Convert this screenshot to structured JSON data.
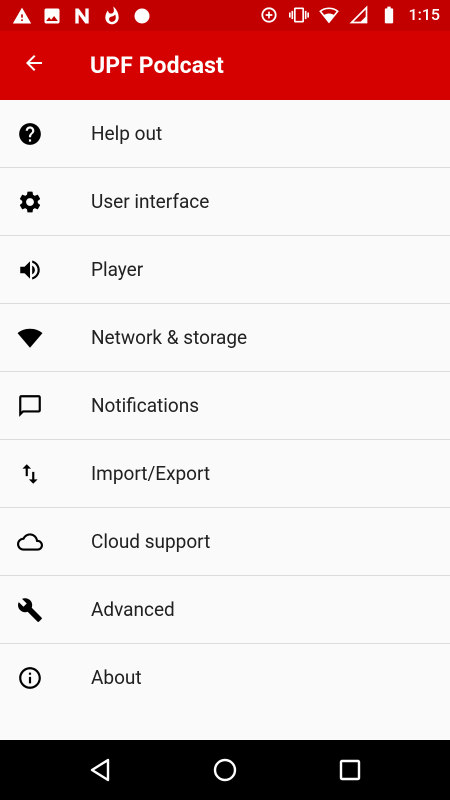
{
  "status_bar": {
    "time": "1:15",
    "left_icons": [
      "warning-icon",
      "image-icon",
      "n-logo-icon",
      "flame-icon",
      "circle-icon"
    ],
    "right_icons": [
      "data-saver-icon",
      "vibrate-icon",
      "wifi-icon",
      "signal-icon",
      "battery-icon"
    ]
  },
  "app_bar": {
    "title": "UPF Podcast",
    "back_icon": "arrow-back-icon"
  },
  "settings": [
    {
      "label": "Help out",
      "icon": "help-icon"
    },
    {
      "label": "User interface",
      "icon": "gear-icon"
    },
    {
      "label": "Player",
      "icon": "volume-icon"
    },
    {
      "label": "Network & storage",
      "icon": "wifi-icon"
    },
    {
      "label": "Notifications",
      "icon": "chat-bubble-icon"
    },
    {
      "label": "Import/Export",
      "icon": "swap-vertical-icon"
    },
    {
      "label": "Cloud support",
      "icon": "cloud-icon"
    },
    {
      "label": "Advanced",
      "icon": "wrench-icon"
    },
    {
      "label": "About",
      "icon": "info-icon"
    }
  ],
  "nav_bar": {
    "buttons": [
      "back-triangle-icon",
      "home-circle-icon",
      "recents-square-icon"
    ]
  },
  "colors": {
    "status_bar": "#c20000",
    "app_bar": "#d50000",
    "background": "#fafafa",
    "text": "#212121",
    "divider": "#dcdcdc"
  }
}
